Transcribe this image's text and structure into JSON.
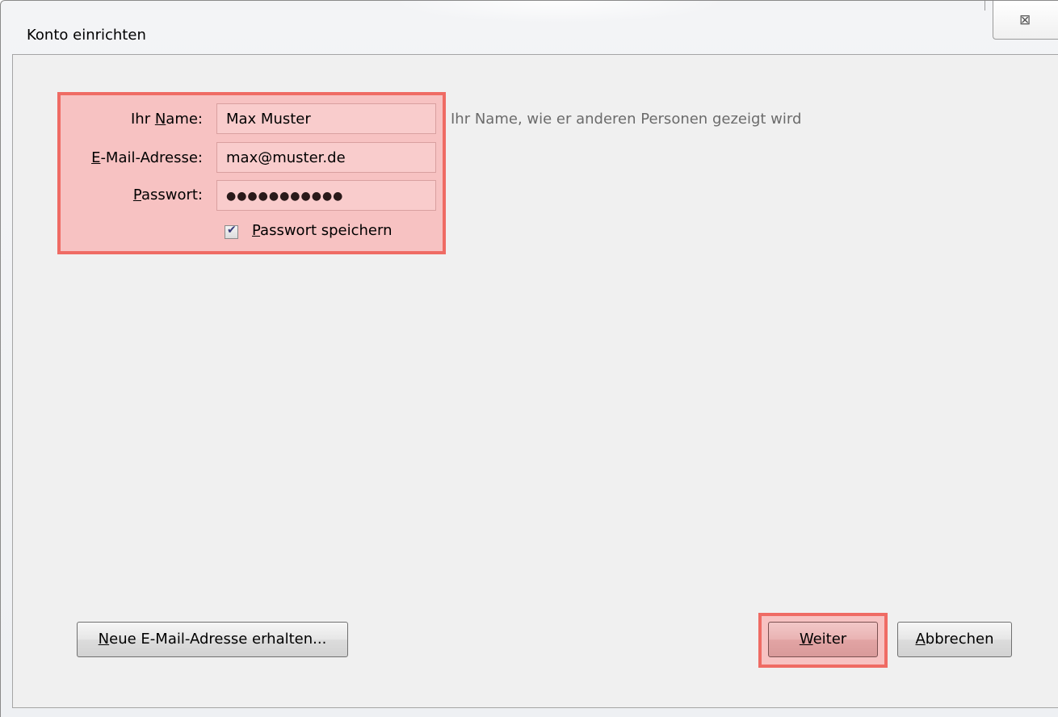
{
  "window": {
    "title": "Konto einrichten",
    "close_glyph": "⊠"
  },
  "form": {
    "name_label_pre": "Ihr ",
    "name_label_u": "N",
    "name_label_post": "ame:",
    "name_value": "Max Muster",
    "name_hint": "Ihr Name, wie er anderen Personen gezeigt wird",
    "email_label_u": "E",
    "email_label_post": "-Mail-Adresse:",
    "email_value": "max@muster.de",
    "password_label_u": "P",
    "password_label_post": "asswort:",
    "password_value": "●●●●●●●●●●●",
    "remember_checked": true,
    "remember_label_u": "P",
    "remember_label_post": "asswort speichern"
  },
  "buttons": {
    "new_u": "N",
    "new_post": "eue E-Mail-Adresse erhalten...",
    "next_u": "W",
    "next_post": "eiter",
    "cancel_u": "A",
    "cancel_post": "bbrechen"
  },
  "colors": {
    "highlight_border": "#ef6b64",
    "highlight_fill": "#f7c2c2"
  }
}
